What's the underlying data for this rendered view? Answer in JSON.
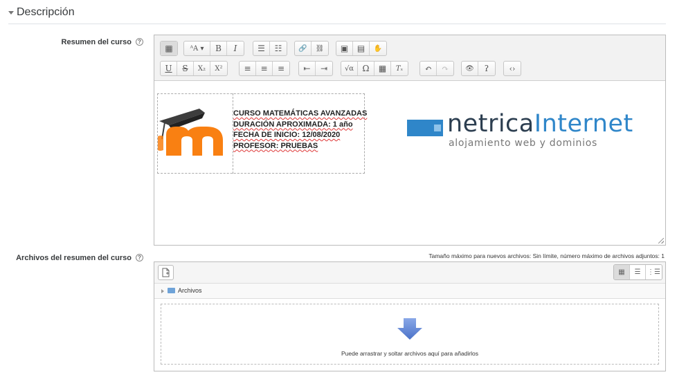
{
  "section": {
    "title": "Descripción"
  },
  "summary": {
    "label": "Resumen del curso",
    "help": "?"
  },
  "toolbar": {
    "row1": [
      {
        "name": "toolbar-toggle",
        "icon": "toolbar-toggle-icon",
        "glyph": "▦"
      },
      {
        "name": "font-style",
        "icon": "font-style-icon",
        "glyph": "ᴬA ▾"
      },
      {
        "name": "bold",
        "icon": "bold-icon",
        "glyph": "B"
      },
      {
        "name": "italic",
        "icon": "italic-icon",
        "glyph": "I"
      },
      {
        "name": "unordered-list",
        "icon": "unordered-list-icon",
        "glyph": "☰"
      },
      {
        "name": "ordered-list",
        "icon": "ordered-list-icon",
        "glyph": "☷"
      },
      {
        "name": "link",
        "icon": "link-icon",
        "glyph": "🔗"
      },
      {
        "name": "unlink",
        "icon": "unlink-icon",
        "glyph": "⛓"
      },
      {
        "name": "image",
        "icon": "image-icon",
        "glyph": "▣"
      },
      {
        "name": "media",
        "icon": "media-icon",
        "glyph": "▤"
      },
      {
        "name": "manage-files",
        "icon": "manage-files-icon",
        "glyph": "✋"
      }
    ],
    "row2": [
      {
        "name": "underline",
        "icon": "underline-icon",
        "glyph": "U"
      },
      {
        "name": "strikethrough",
        "icon": "strikethrough-icon",
        "glyph": "S"
      },
      {
        "name": "subscript",
        "icon": "subscript-icon",
        "glyph": "X₂"
      },
      {
        "name": "superscript",
        "icon": "superscript-icon",
        "glyph": "X²"
      },
      {
        "name": "align-left",
        "icon": "align-left-icon",
        "glyph": "≡"
      },
      {
        "name": "align-center",
        "icon": "align-center-icon",
        "glyph": "≡"
      },
      {
        "name": "align-right",
        "icon": "align-right-icon",
        "glyph": "≡"
      },
      {
        "name": "outdent",
        "icon": "outdent-icon",
        "glyph": "⇤"
      },
      {
        "name": "indent",
        "icon": "indent-icon",
        "glyph": "⇥"
      },
      {
        "name": "equation",
        "icon": "equation-icon",
        "glyph": "√α"
      },
      {
        "name": "special-char",
        "icon": "omega-icon",
        "glyph": "Ω"
      },
      {
        "name": "table",
        "icon": "table-icon",
        "glyph": "▦"
      },
      {
        "name": "clear-formatting",
        "icon": "clear-formatting-icon",
        "glyph": "Tₓ"
      },
      {
        "name": "undo",
        "icon": "undo-icon",
        "glyph": "↶"
      },
      {
        "name": "redo",
        "icon": "redo-icon",
        "glyph": "↷"
      },
      {
        "name": "accessibility-checker",
        "icon": "eye-slash-icon",
        "glyph": "👁"
      },
      {
        "name": "screenreader-helper",
        "icon": "ear-icon",
        "glyph": "ʔ"
      },
      {
        "name": "html-source",
        "icon": "code-icon",
        "glyph": "‹›"
      }
    ]
  },
  "content": {
    "course_lines": [
      "CURSO MATEMÁTICAS AVANZADAS",
      "DURACIÓN APROXIMADA: 1 año",
      "FECHA DE INICIO: 12/08/2020",
      "PROFESOR: PRUEBAS"
    ],
    "logo_moodle": "moodle-logo",
    "logo_netrica": {
      "name_part1": "netrica",
      "name_part2": "Internet",
      "tagline": "alojamiento web y dominios"
    }
  },
  "files": {
    "label": "Archivos del resumen del curso",
    "help": "?",
    "max_info": "Tamaño máximo para nuevos archivos: Sin límite, número máximo de archivos adjuntos: 1",
    "path_folder": "Archivos",
    "drop_text": "Puede arrastrar y soltar archivos aquí para añadirlos"
  },
  "colors": {
    "brand_blue": "#2f86c9",
    "moodle_orange": "#f98012"
  }
}
